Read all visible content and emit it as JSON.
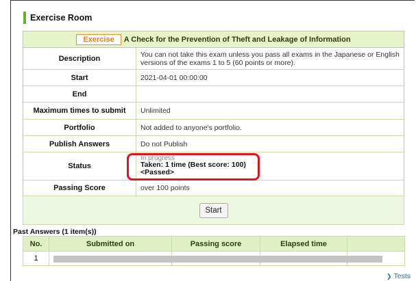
{
  "page": {
    "room_title": "Exercise Room"
  },
  "exercise": {
    "badge": "Exercise",
    "title": "A Check for the Prevention of Theft and Leakage of Information"
  },
  "info_rows": [
    {
      "label": "Description",
      "value": "You can not take this exam unless you pass all exams in the Japanese or English versions of the exams 1 to 5 (60 points or more)."
    },
    {
      "label": "Start",
      "value": "2021-04-01 00:00:00"
    },
    {
      "label": "End",
      "value": ""
    },
    {
      "label": "Maximum times to submit",
      "value": "Unlimited"
    },
    {
      "label": "Portfolio",
      "value": "Not added to anyone's portfolio."
    },
    {
      "label": "Publish Answers",
      "value": "Do not Publish"
    }
  ],
  "status": {
    "label": "Status",
    "progress": "In progress",
    "taken": "Taken: 1 time  (Best score: 100)",
    "result": "<Passed>"
  },
  "passing": {
    "label": "Passing Score",
    "value": "over 100 points"
  },
  "start_button": {
    "label": "Start"
  },
  "past_answers": {
    "title": "Past Answers (1 item(s))",
    "columns": [
      "No.",
      "Submitted on",
      "Passing score",
      "Elapsed time",
      ""
    ],
    "rows": [
      {
        "no": "1"
      }
    ]
  },
  "footer": {
    "tests_link": "Tests"
  },
  "colors": {
    "accent_green": "#66b22a",
    "badge_orange": "#f07a1a",
    "highlight_red": "#e8101a",
    "link_blue": "#2b6ea8"
  }
}
